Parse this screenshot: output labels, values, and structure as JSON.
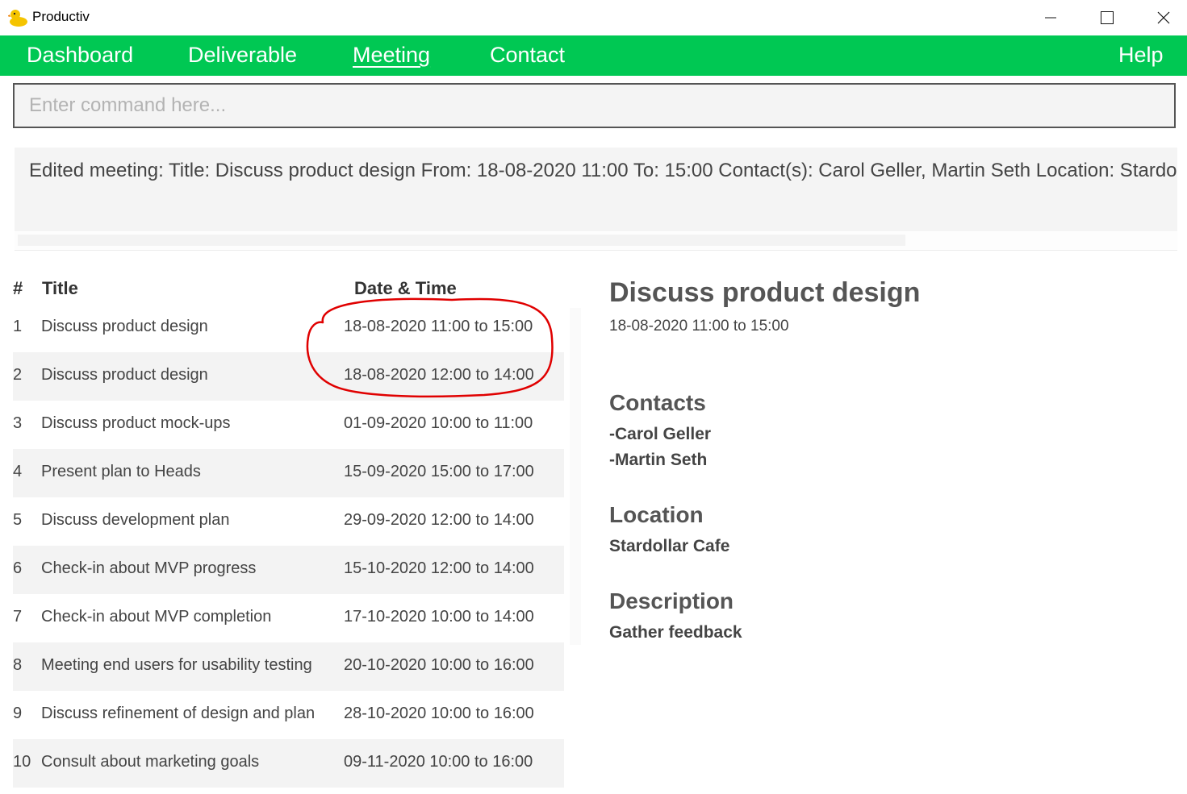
{
  "window": {
    "title": "Productiv",
    "app_icon": "rubber-duck-icon"
  },
  "menu": {
    "items": [
      {
        "label": "Dashboard",
        "active": false
      },
      {
        "label": "Deliverable",
        "active": false
      },
      {
        "label": "Meeting",
        "active": true
      },
      {
        "label": "Contact",
        "active": false
      }
    ],
    "help_label": "Help"
  },
  "command": {
    "placeholder": "Enter command here...",
    "value": ""
  },
  "result": {
    "text": "Edited meeting: Title: Discuss product design From: 18-08-2020 11:00 To: 15:00 Contact(s): Carol Geller, Martin Seth Location: Stardollar Cafe"
  },
  "list": {
    "headers": {
      "index": "#",
      "title": "Title",
      "datetime": "Date & Time"
    },
    "rows": [
      {
        "index": "1",
        "title": "Discuss product design",
        "datetime": "18-08-2020 11:00 to 15:00"
      },
      {
        "index": "2",
        "title": "Discuss product design",
        "datetime": "18-08-2020 12:00 to 14:00"
      },
      {
        "index": "3",
        "title": "Discuss product mock-ups",
        "datetime": "01-09-2020 10:00 to 11:00"
      },
      {
        "index": "4",
        "title": "Present plan to Heads",
        "datetime": "15-09-2020 15:00 to 17:00"
      },
      {
        "index": "5",
        "title": "Discuss development plan",
        "datetime": "29-09-2020 12:00 to 14:00"
      },
      {
        "index": "6",
        "title": "Check-in about MVP progress",
        "datetime": "15-10-2020 12:00 to 14:00"
      },
      {
        "index": "7",
        "title": "Check-in about MVP completion",
        "datetime": "17-10-2020 10:00 to 14:00"
      },
      {
        "index": "8",
        "title": "Meeting end users for usability testing",
        "datetime": "20-10-2020 10:00 to 16:00"
      },
      {
        "index": "9",
        "title": "Discuss refinement of design and plan",
        "datetime": "28-10-2020 10:00 to 16:00"
      },
      {
        "index": "10",
        "title": "Consult about marketing goals",
        "datetime": "09-11-2020 10:00 to 16:00"
      }
    ]
  },
  "detail": {
    "title": "Discuss product design",
    "datetime": "18-08-2020 11:00 to 15:00",
    "contacts_label": "Contacts",
    "contacts": [
      "-Carol Geller",
      "-Martin Seth"
    ],
    "location_label": "Location",
    "location": "Stardollar Cafe",
    "description_label": "Description",
    "description": "Gather feedback"
  },
  "colors": {
    "menu_bar": "#00c853",
    "annotation": "#e00000"
  }
}
